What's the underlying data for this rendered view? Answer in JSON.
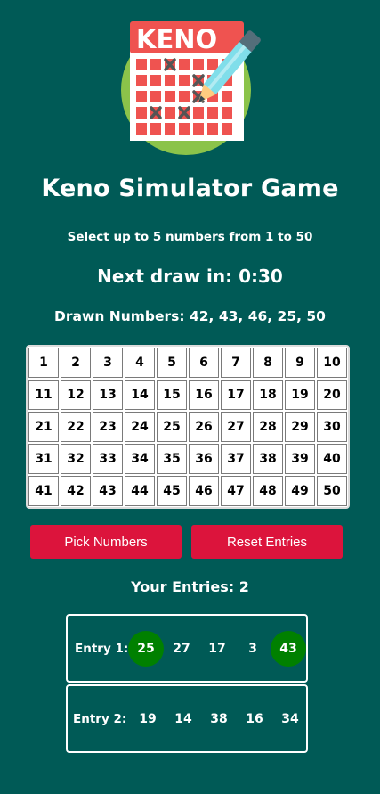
{
  "app": {
    "title": "Keno Simulator Game",
    "instructions": "Select up to 5 numbers from 1 to 50",
    "next_draw_label": "Next draw in: 0:30",
    "drawn_label": "Drawn Numbers: 42, 43, 46, 25, 50"
  },
  "logo": {
    "text": "KENO",
    "icon": "keno-ticket-with-pen-icon"
  },
  "board": {
    "numbers": [
      "1",
      "2",
      "3",
      "4",
      "5",
      "6",
      "7",
      "8",
      "9",
      "10",
      "11",
      "12",
      "13",
      "14",
      "15",
      "16",
      "17",
      "18",
      "19",
      "20",
      "21",
      "22",
      "23",
      "24",
      "25",
      "26",
      "27",
      "28",
      "29",
      "30",
      "31",
      "32",
      "33",
      "34",
      "35",
      "36",
      "37",
      "38",
      "39",
      "40",
      "41",
      "42",
      "43",
      "44",
      "45",
      "46",
      "47",
      "48",
      "49",
      "50"
    ]
  },
  "buttons": {
    "pick": "Pick Numbers",
    "reset": "Reset Entries"
  },
  "entries": {
    "count_label": "Your Entries: 2",
    "list": [
      {
        "label": "Entry 1:",
        "numbers": [
          {
            "value": "25",
            "hit": true
          },
          {
            "value": "27",
            "hit": false
          },
          {
            "value": "17",
            "hit": false
          },
          {
            "value": "3",
            "hit": false
          },
          {
            "value": "43",
            "hit": true
          }
        ]
      },
      {
        "label": "Entry 2:",
        "numbers": [
          {
            "value": "19",
            "hit": false
          },
          {
            "value": "14",
            "hit": false
          },
          {
            "value": "38",
            "hit": false
          },
          {
            "value": "16",
            "hit": false
          },
          {
            "value": "34",
            "hit": false
          }
        ]
      }
    ]
  },
  "colors": {
    "background": "#005a56",
    "button": "#dc143c",
    "hit": "#008000",
    "logo_circle": "#8bc34a",
    "logo_red": "#ef5350"
  }
}
